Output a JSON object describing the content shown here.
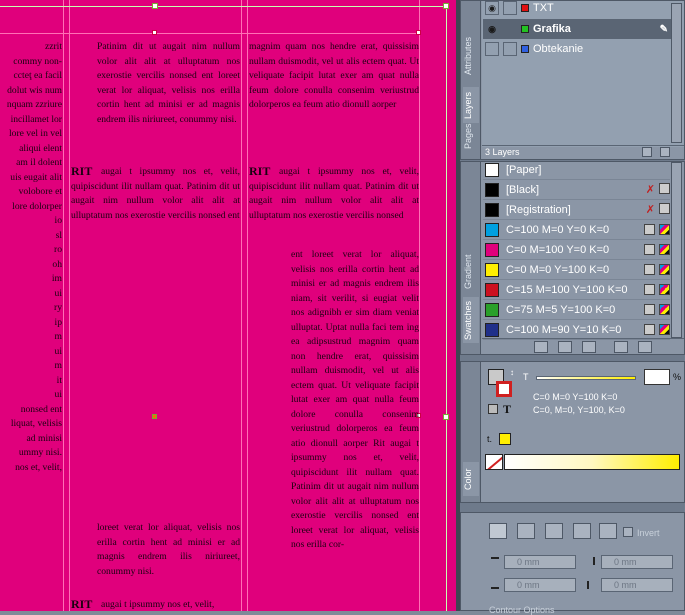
{
  "document": {
    "col0_lines": [
      "zzrit",
      "commy non-",
      "ccteţ ea facil",
      "dolut wis num",
      "nquam zzriure",
      "incillamet lor",
      "lore vel in vel",
      "aliqui elent",
      "am il dolent",
      "uis eugait alit",
      "volobore et",
      "lore dolorper",
      "io",
      "sl",
      "ro",
      "oh",
      "im",
      "ui",
      "ry",
      "ip",
      "m",
      "ui",
      "m",
      "it",
      "ui",
      "nonsed ent",
      "liquat, velisis",
      "ad minisi",
      "ummy nisi.",
      "nos et, velit,"
    ],
    "col1_top": "Patinim dit ut augait nim nullum volor alit alit at ulluptatum nos exerostie vercilis nonsed ent loreet verat lor aliquat, velisis nos erilla cortin hent ad minisi er ad magnis endrem ilis niriureet, conummy nisi.",
    "col1_mid": "augai t ipsummy nos et, velit, quipiscidunt ilit nullam quat. Patinim dit ut augait nim nullum volor alit alit at ulluptatum nos exerostie vercilis nonsed ent",
    "col1_bottom": "loreet verat lor aliquat, velisis nos erilla cortin hent ad minisi er ad magnis endrem ilis niriureet, conummy nisi.",
    "col1_last": "augai t ipsummy nos et, velit,",
    "col2_top": "magnim quam nos hendre erat, quissisim nullam duismodit, vel ut alis ectem quat. Ut veliquate facipit lutat exer am quat nulla feum dolore conulla consenim veriustrud dolorperos ea feum atio dionull aorper",
    "col2_mid": "augai t ipsummy nos et, velit, quipiscidunt ilit nullam quat. Patinim dit ut augait nim nullum volor alit alit at ulluptatum nos exerostie vercilis nonsed",
    "col2_indent": "ent loreet verat lor aliquat, velisis nos erilla cortin hent ad minisi er ad magnis endrem ilis niam, sit verilit, si eugiat velit nos adignibh er sim diam veniat ulluptat. Uptat nulla faci tem ing ea adipsustrud magnim quam non hendre erat, quissisim nullam duismodit, vel ut alis ectem quat. Ut veliquate facipit lutat exer am quat nulla feum dolore conulla consenim veriustrud dolorperos ea feum atio dionull aorper Rit augai t ipsummy nos et, velit, quipiscidunt ilit nullam quat. Patinim dit ut augait nim nullum volor alit alit at ulluptatum nos exerostie vercilis nonsed ent loreet verat lor aliquat, velisis nos erilla cor-",
    "rit": "RIT"
  },
  "layers": {
    "tabs": [
      "Attributes",
      "Layers",
      "Pages"
    ],
    "items": [
      {
        "name": "TXT",
        "color": "#e01010"
      },
      {
        "name": "Grafika",
        "color": "#22c222",
        "selected": true
      },
      {
        "name": "Obtekanie",
        "color": "#3060e0"
      }
    ],
    "count_label": "3 Layers"
  },
  "swatches": {
    "tabs": [
      "Gradient",
      "Swatches"
    ],
    "items": [
      {
        "name": "[Paper]",
        "color": "#ffffff"
      },
      {
        "name": "[Black]",
        "color": "#000000"
      },
      {
        "name": "[Registration]",
        "color": "#000000"
      },
      {
        "name": "C=100 M=0 Y=0 K=0",
        "color": "#00a0e0"
      },
      {
        "name": "C=0 M=100 Y=0 K=0",
        "color": "#e0007c"
      },
      {
        "name": "C=0 M=0 Y=100 K=0",
        "color": "#ffee00"
      },
      {
        "name": "C=15 M=100 Y=100 K=0",
        "color": "#cc1020"
      },
      {
        "name": "C=75 M=5 Y=100 K=0",
        "color": "#2aa02a"
      },
      {
        "name": "C=100 M=90 Y=10 K=0",
        "color": "#20308a"
      }
    ]
  },
  "color": {
    "tab": "Color",
    "tint_label": "T",
    "percent_sign": "%",
    "line1": "C=0 M=0 Y=100 K=0",
    "line2": "C=0, M=0, Y=100, K=0",
    "fill_color": "#ffee00"
  },
  "wrap": {
    "invert_label": "Invert",
    "offset_top": "0 mm",
    "offset_right": "0 mm",
    "offset_bottom": "0 mm",
    "offset_left": "0 mm",
    "contour_label": "Contour Options"
  }
}
